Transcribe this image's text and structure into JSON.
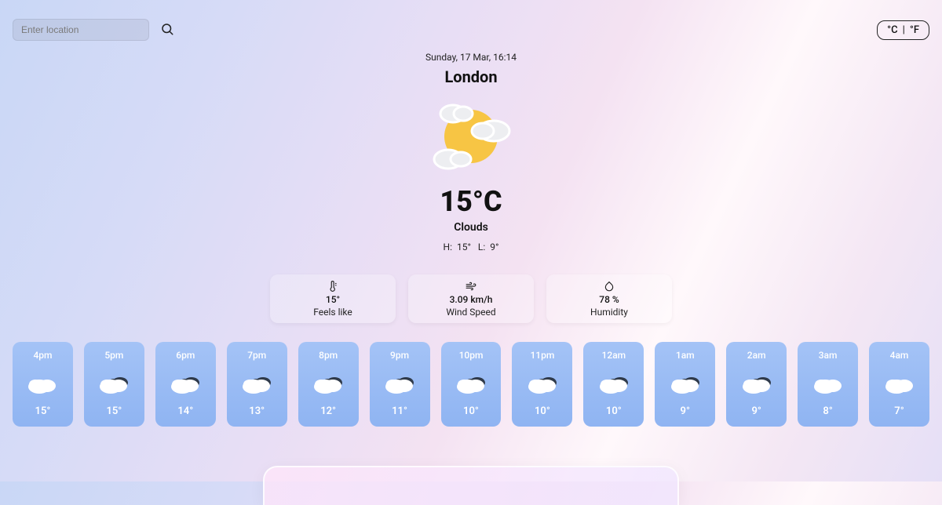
{
  "search": {
    "placeholder": "Enter location",
    "icon": "search-icon"
  },
  "units": {
    "celsius": "°C",
    "fahrenheit": "°F"
  },
  "current": {
    "date": "Sunday, 17 Mar, 16:14",
    "city": "London",
    "temperature": "15°C",
    "condition": "Clouds",
    "high_label": "H:",
    "high": "15°",
    "low_label": "L:",
    "low": "9°"
  },
  "metrics": [
    {
      "icon": "thermometer-icon",
      "value": "15°",
      "label": "Feels like"
    },
    {
      "icon": "wind-icon",
      "value": "3.09 km/h",
      "label": "Wind Speed"
    },
    {
      "icon": "droplet-icon",
      "value": "78 %",
      "label": "Humidity"
    }
  ],
  "hourly": [
    {
      "time": "4pm",
      "icon": "cloud",
      "temp": "15°"
    },
    {
      "time": "5pm",
      "icon": "cloud-dark",
      "temp": "15°"
    },
    {
      "time": "6pm",
      "icon": "cloud-dark",
      "temp": "14°"
    },
    {
      "time": "7pm",
      "icon": "cloud-dark",
      "temp": "13°"
    },
    {
      "time": "8pm",
      "icon": "cloud-dark",
      "temp": "12°"
    },
    {
      "time": "9pm",
      "icon": "cloud-dark",
      "temp": "11°"
    },
    {
      "time": "10pm",
      "icon": "cloud-dark",
      "temp": "10°"
    },
    {
      "time": "11pm",
      "icon": "cloud-dark",
      "temp": "10°"
    },
    {
      "time": "12am",
      "icon": "cloud-dark",
      "temp": "10°"
    },
    {
      "time": "1am",
      "icon": "cloud-dark",
      "temp": "9°"
    },
    {
      "time": "2am",
      "icon": "cloud-dark",
      "temp": "9°"
    },
    {
      "time": "3am",
      "icon": "cloud",
      "temp": "8°"
    },
    {
      "time": "4am",
      "icon": "cloud",
      "temp": "7°"
    }
  ]
}
